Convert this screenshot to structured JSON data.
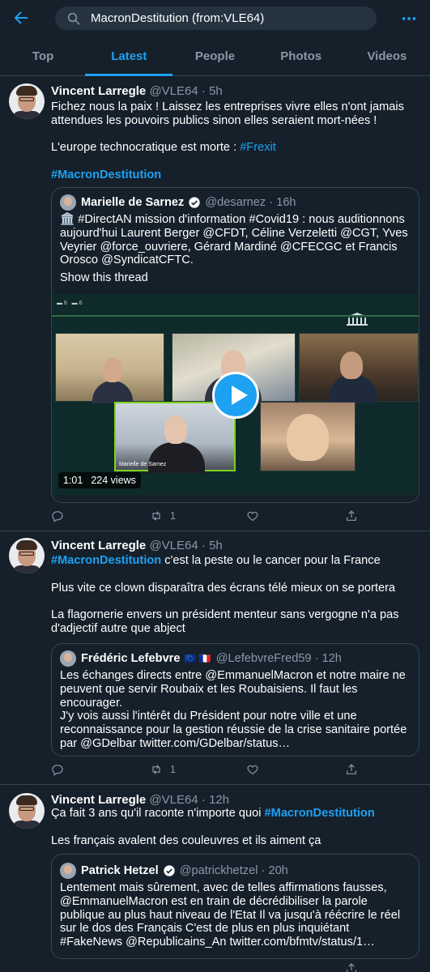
{
  "header": {
    "search_value": "MacronDestitution (from:VLE64)"
  },
  "tabs": [
    {
      "label": "Top"
    },
    {
      "label": "Latest"
    },
    {
      "label": "People"
    },
    {
      "label": "Photos"
    },
    {
      "label": "Videos"
    }
  ],
  "tweets": [
    {
      "name": "Vincent Larregle",
      "handle": "@VLE64",
      "time": "5h",
      "text": {
        "line1": "Fichez nous la paix ! Laissez les entreprises vivre elles n'ont jamais attendues les pouvoirs publics sinon elles seraient mort-nées !",
        "line2": "L'europe technocratique est morte : ",
        "line2_tag": "#Frexit",
        "hashtag": "#MacronDestitution"
      },
      "quote": {
        "name": "Marielle de Sarnez",
        "handle": "@desarnez",
        "time": "16h",
        "text": "🏛️ #DirectAN mission d'information #Covid19 : nous auditionnons aujourd'hui Laurent Berger @CFDT, Céline Verzeletti @CGT, Yves Veyrier @force_ouvriere, Gérard Mardiné @CFECGC et Francis Orosco @SyndicatCFTC.",
        "show_thread": "Show this thread",
        "video_label": "Marielle de Sarnez",
        "duration": "1:01",
        "views": "224 views"
      },
      "replies": "",
      "retweets": "1",
      "likes": ""
    },
    {
      "name": "Vincent Larregle",
      "handle": "@VLE64",
      "time": "5h",
      "text": {
        "hashtag": "#MacronDestitution",
        "line1": " c'est la peste ou le cancer pour la France",
        "line2": "Plus vite ce clown disparaîtra des écrans télé mieux on se portera",
        "line3": "La flagornerie envers un président menteur sans vergogne n'a pas d'adjectif autre que abject"
      },
      "quote": {
        "name": "Frédéric Lefebvre",
        "flags": "🇪🇺 🇫🇷",
        "handle": "@LefebvreFred59",
        "time": "12h",
        "text": "Les échanges directs entre @EmmanuelMacron et notre maire ne peuvent que servir Roubaix et les Roubaisiens. Il faut les encourager.\nJ'y vois aussi l'intérêt du Président pour notre ville et une reconnaissance pour la gestion réussie de la crise sanitaire portée par @GDelbar twitter.com/GDelbar/status…"
      },
      "replies": "",
      "retweets": "1",
      "likes": ""
    },
    {
      "name": "Vincent Larregle",
      "handle": "@VLE64",
      "time": "12h",
      "text": {
        "line1": "Ça fait 3 ans qu'il raconte n'importe quoi ",
        "hashtag": "#MacronDestitution",
        "line2": "Les français avalent des couleuvres et ils aiment ça"
      },
      "quote": {
        "name": "Patrick Hetzel",
        "handle": "@patrickhetzel",
        "time": "20h",
        "text": "Lentement mais sûrement, avec de telles affirmations fausses, @EmmanuelMacron est en train de décrédibiliser la parole publique au plus haut niveau de l'Etat Il va jusqu'à réécrire le réel sur le dos des Français C'est de plus en plus inquiétant #FakeNews @Republicains_An twitter.com/bfmtv/status/1…"
      }
    }
  ],
  "colors": {
    "background": "#15202b",
    "accent": "#1da1f2",
    "muted": "#8899a6",
    "border": "#38444d"
  }
}
